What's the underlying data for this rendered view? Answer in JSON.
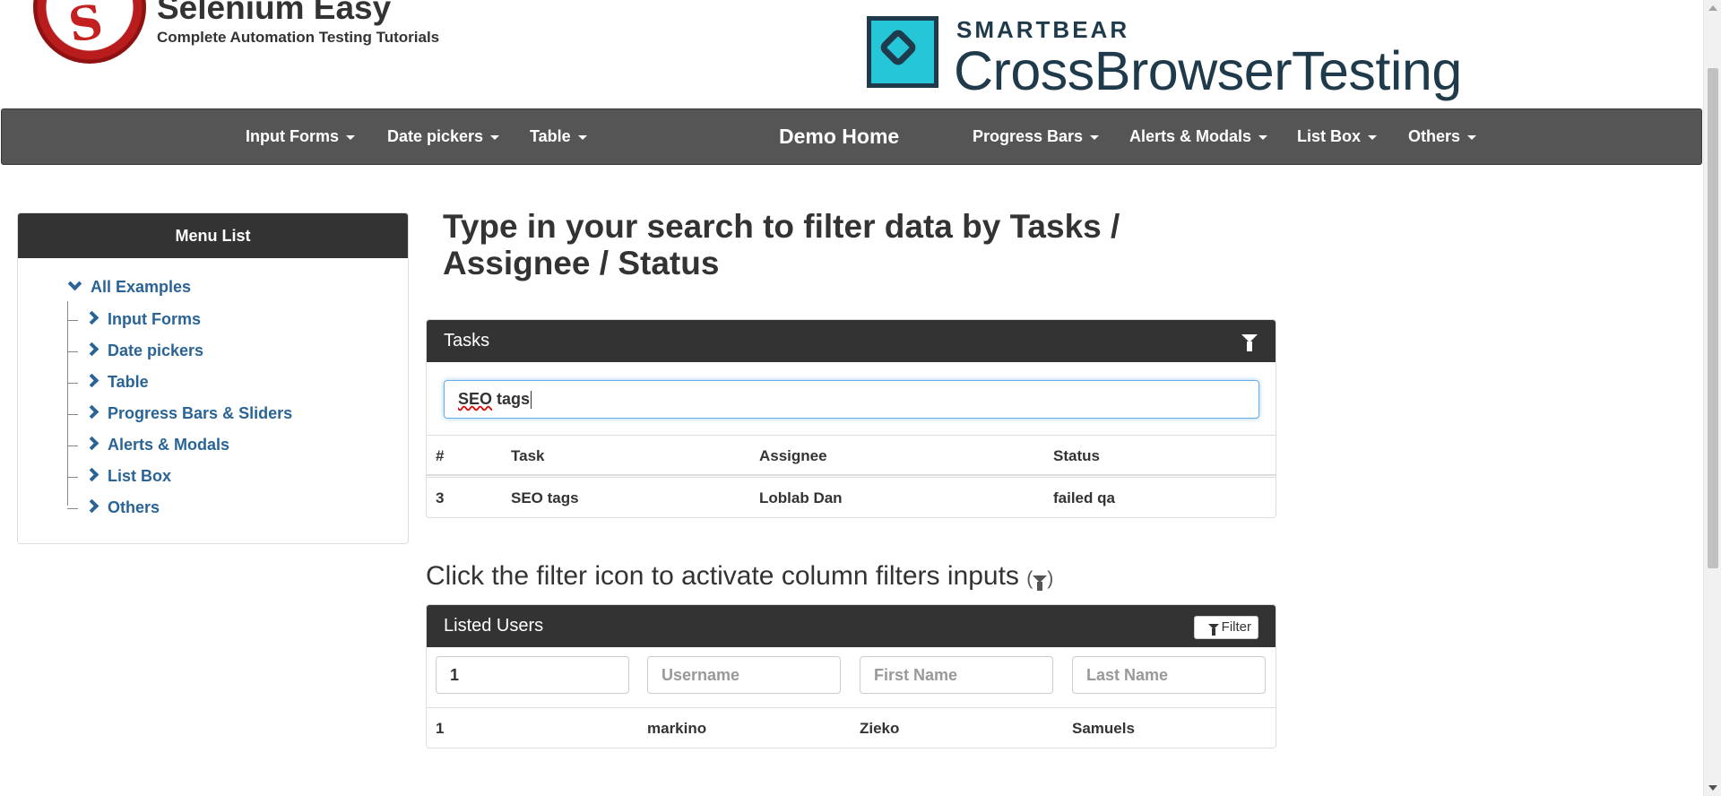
{
  "brand": {
    "title": "Selenium Easy",
    "subtitle": "Complete Automation Testing Tutorials",
    "logo_icon": "selenium-easy-logo"
  },
  "sponsor": {
    "top": "SMARTBEAR",
    "name": "CrossBrowserTesting",
    "colors": {
      "dark": "#1f3a4a",
      "accent": "#25c6d8"
    }
  },
  "navbar": {
    "items": [
      {
        "label": "Input Forms"
      },
      {
        "label": "Date pickers"
      },
      {
        "label": "Table"
      },
      {
        "label": "Demo Home"
      },
      {
        "label": "Progress Bars"
      },
      {
        "label": "Alerts & Modals"
      },
      {
        "label": "List Box"
      },
      {
        "label": "Others"
      }
    ],
    "background": "#555555"
  },
  "sidebar": {
    "title": "Menu List",
    "root": "All Examples",
    "items": [
      {
        "label": "Input Forms"
      },
      {
        "label": "Date pickers"
      },
      {
        "label": "Table"
      },
      {
        "label": "Progress Bars & Sliders"
      },
      {
        "label": "Alerts & Modals"
      },
      {
        "label": "List Box"
      },
      {
        "label": "Others"
      }
    ]
  },
  "main": {
    "heading": "Type in your search to filter data by Tasks / Assignee / Status",
    "tasks_panel": {
      "title": "Tasks",
      "search_value_word1": "SEO",
      "search_value_word2": "tags",
      "columns": [
        "#",
        "Task",
        "Assignee",
        "Status"
      ],
      "rows": [
        {
          "id": "3",
          "task": "SEO tags",
          "assignee": "Loblab Dan",
          "status": "failed qa"
        }
      ]
    },
    "sub_heading": "Click the filter icon to activate column filters inputs",
    "users_panel": {
      "title": "Listed Users",
      "filter_label": "Filter",
      "inputs": {
        "id_value": "1",
        "username_placeholder": "Username",
        "first_name_placeholder": "First Name",
        "last_name_placeholder": "Last Name"
      },
      "rows": [
        {
          "id": "1",
          "username": "markino",
          "first_name": "Zieko",
          "last_name": "Samuels"
        }
      ]
    }
  },
  "colors": {
    "link": "#2a6496",
    "panel_head": "#333333",
    "focus": "#66afe9"
  }
}
